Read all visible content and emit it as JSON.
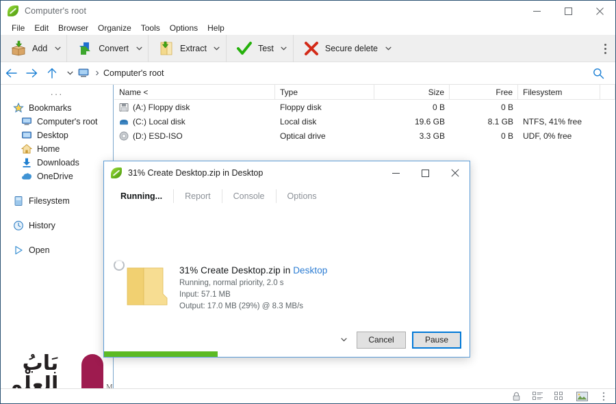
{
  "window": {
    "title": "Computer's root",
    "app_icon": "peazip-leaf-icon",
    "controls": {
      "minimize": "–",
      "maximize": "□",
      "close": "✕"
    }
  },
  "menu": {
    "items": [
      "File",
      "Edit",
      "Browser",
      "Organize",
      "Tools",
      "Options",
      "Help"
    ]
  },
  "toolbar": {
    "buttons": [
      {
        "label": "Add",
        "icon": "add-archive-box-icon",
        "caret": true
      },
      {
        "label": "Convert",
        "icon": "convert-arrows-icon",
        "caret": true
      },
      {
        "label": "Extract",
        "icon": "extract-folder-icon",
        "caret": true
      },
      {
        "label": "Test",
        "icon": "test-checkmark-icon",
        "caret": true
      },
      {
        "label": "Secure delete",
        "icon": "secure-delete-x-icon",
        "caret": true
      }
    ],
    "overflow_icon": "kebab-menu-icon"
  },
  "address_bar": {
    "back_icon": "arrow-left-icon",
    "forward_icon": "arrow-right-icon",
    "up_icon": "arrow-up-icon",
    "history_caret_icon": "chevron-down-icon",
    "location_icon": "computer-monitor-icon",
    "separator": "›",
    "path": "Computer's root",
    "search_icon": "search-icon"
  },
  "sidebar": {
    "overflow": "···",
    "items": [
      {
        "label": "Bookmarks",
        "icon": "star-icon",
        "indent": false,
        "spaced": false
      },
      {
        "label": "Computer's root",
        "icon": "computer-icon",
        "indent": true,
        "spaced": false
      },
      {
        "label": "Desktop",
        "icon": "desktop-icon",
        "indent": true,
        "spaced": false
      },
      {
        "label": "Home",
        "icon": "home-icon",
        "indent": true,
        "spaced": false
      },
      {
        "label": "Downloads",
        "icon": "download-icon",
        "indent": true,
        "spaced": false
      },
      {
        "label": "OneDrive",
        "icon": "cloud-icon",
        "indent": true,
        "spaced": false
      },
      {
        "label": "Filesystem",
        "icon": "drive-icon",
        "indent": false,
        "spaced": true
      },
      {
        "label": "History",
        "icon": "clock-icon",
        "indent": false,
        "spaced": true
      },
      {
        "label": "Open",
        "icon": "play-icon",
        "indent": false,
        "spaced": true
      }
    ]
  },
  "filelist": {
    "columns": [
      "Name <",
      "Type",
      "Size",
      "Free",
      "Filesystem"
    ],
    "rows": [
      {
        "icon": "floppy-disk-icon",
        "name": "(A:) Floppy disk",
        "type": "Floppy disk",
        "size": "0 B",
        "free": "0 B",
        "filesystem": ""
      },
      {
        "icon": "hard-disk-icon",
        "name": "(C:) Local disk",
        "type": "Local disk",
        "size": "19.6 GB",
        "free": "8.1 GB",
        "filesystem": "NTFS, 41% free"
      },
      {
        "icon": "optical-disc-icon",
        "name": "(D:) ESD-ISO",
        "type": "Optical drive",
        "size": "3.3 GB",
        "free": "0 B",
        "filesystem": "UDF, 0% free"
      }
    ]
  },
  "statusbar": {
    "icons": [
      "lock-icon",
      "list-view-icon",
      "detail-view-icon",
      "thumbnail-view-icon",
      "kebab-menu-icon"
    ]
  },
  "watermark": {
    "arabic_line1": "بَابُ",
    "arabic_line2": "العِلْم",
    "trademark": "M"
  },
  "dialog": {
    "title": "31% Create Desktop.zip in Desktop",
    "app_icon": "peazip-leaf-icon",
    "controls": {
      "minimize": "–",
      "maximize": "□",
      "close": "✕"
    },
    "tabs": [
      {
        "label": "Running...",
        "active": true
      },
      {
        "label": "Report",
        "active": false
      },
      {
        "label": "Console",
        "active": false
      },
      {
        "label": "Options",
        "active": false
      }
    ],
    "job": {
      "spinner": "loading-spinner-icon",
      "folder_icon": "folder-icon",
      "headline_prefix": "31% Create Desktop.zip in ",
      "headline_location": "Desktop",
      "status": "Running, normal priority, 2.0 s",
      "input": "Input: 57.1 MB",
      "output": "Output: 17.0 MB (29%) @ 8.3 MB/s"
    },
    "footer": {
      "expand_icon": "chevron-down-icon",
      "cancel_label": "Cancel",
      "pause_label": "Pause"
    },
    "progress": {
      "percent": 31,
      "color": "#5cba23"
    }
  },
  "colors": {
    "accent": "#0078d7",
    "window_border": "#2b5173",
    "dialog_border": "#5b9bd5",
    "toolbar_bg": "#efefef",
    "link": "#2b7cd3",
    "progress_green": "#5cba23"
  }
}
